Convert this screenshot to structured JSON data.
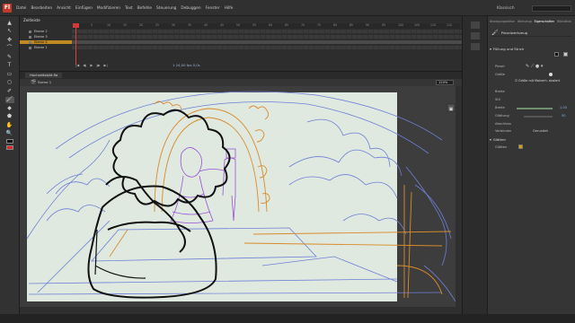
{
  "app": {
    "logo": "Fl",
    "menu": [
      "Datei",
      "Bearbeiten",
      "Ansicht",
      "Einfügen",
      "Modifizieren",
      "Text",
      "Befehle",
      "Steuerung",
      "Debuggen",
      "Fenster",
      "Hilfe"
    ],
    "workspace": "Klassisch"
  },
  "timeline": {
    "tab_label": "Zeitleiste",
    "ruler_ticks": [
      "1",
      "5",
      "10",
      "15",
      "20",
      "25",
      "30",
      "35",
      "40",
      "45",
      "50",
      "55",
      "60",
      "65",
      "70",
      "75",
      "80",
      "85",
      "90",
      "95",
      "100",
      "105",
      "110",
      "115"
    ],
    "layers": [
      {
        "name": "Ebene 2",
        "active": false
      },
      {
        "name": "Ebene 3",
        "active": false
      },
      {
        "name": "Ebene 4",
        "active": true
      },
      {
        "name": "Ebene 1",
        "active": false
      }
    ],
    "controls": [
      "|◀",
      "◀|",
      "▶",
      "|▶",
      "▶|"
    ],
    "counter": "1  24,00 fps  0,0s"
  },
  "document": {
    "tab": "Hochzeitsbild.fla",
    "scene": "Szene 1",
    "zoom": "120%"
  },
  "toolbar": {
    "tools": [
      "▲",
      "↖",
      "✥",
      "⌒",
      "✎",
      "T",
      "▭",
      "○",
      "✐",
      "🖌",
      "◆",
      "⬟",
      "✋",
      "🔍"
    ],
    "stroke_color": "#111111",
    "fill_color": "#d62c2c"
  },
  "properties": {
    "tabs": [
      "Bewegungseditor",
      "Werkzeug",
      "Eigenschaften",
      "Bibliothek"
    ],
    "active_tab": "Eigenschaften",
    "tool_name": "Pinselwerkzeug",
    "section_fill_stroke": "Füllung und Strich",
    "pinsel_label": "Pinsel",
    "groesse_label": "Größe",
    "groesse_check": "Größe mit Malverh. skaliert",
    "breite_label": "Breite",
    "stil_label": "Stil",
    "breite2_label": "Breite",
    "breite2_value": "1,00",
    "glaettung_label": "Glättung",
    "glaettung_value": "50",
    "abschluss_label": "Abschluss",
    "verbinden_label": "Verbinden",
    "verbinden_value": "Gerundet",
    "section_glaetten": "Glätten",
    "glaetten_label": "Glätten"
  }
}
